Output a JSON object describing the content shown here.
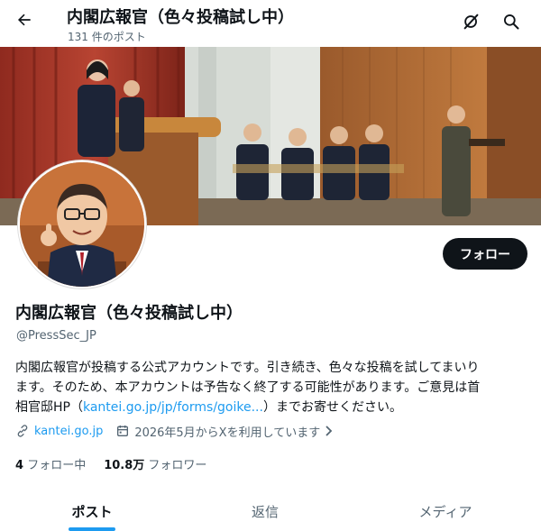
{
  "header": {
    "title": "内閣広報官（色々投稿試し中）",
    "post_count": "131 件のポスト",
    "icons": [
      "back-arrow-icon",
      "grok-icon",
      "search-icon"
    ]
  },
  "profile": {
    "name": "内閣広報官（色々投稿試し中）",
    "handle": "@PressSec_JP",
    "follow_label": "フォロー",
    "bio": {
      "line1": "内閣広報官が投稿する公式アカウントです。引き続き、色々な投稿を試してまいり",
      "line2": "ます。そのため、本アカウントは予告なく終了する可能性があります。ご意見は首",
      "line3_prefix": "相官邸HP（",
      "line3_link": "kantei.go.jp/jp/forms/goike...",
      "line3_suffix": "）までお寄せください。"
    },
    "website": "kantei.go.jp",
    "joined": "2026年5月からXを利用しています",
    "following_count": "4",
    "following_label": "フォロー中",
    "followers_count": "10.8万",
    "followers_label": "フォロワー"
  },
  "tabs": [
    {
      "label": "ポスト",
      "active": true
    },
    {
      "label": "返信",
      "active": false
    },
    {
      "label": "メディア",
      "active": false
    }
  ],
  "colors": {
    "accent": "#1d9bf0",
    "text": "#0f1419",
    "muted": "#536471",
    "button": "#0f1419"
  }
}
